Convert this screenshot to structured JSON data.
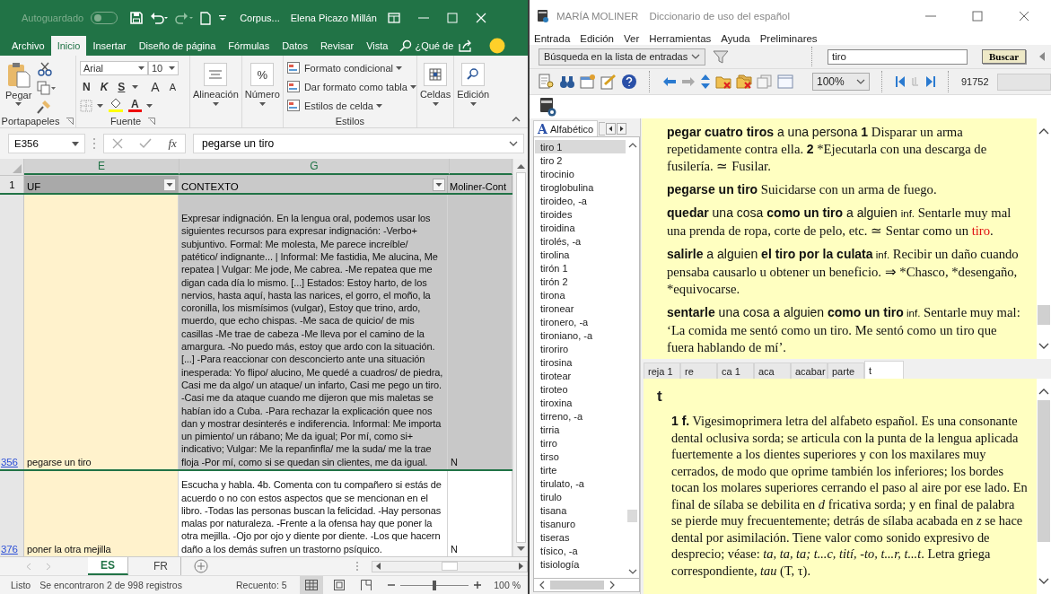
{
  "excel": {
    "titlebar": {
      "autosave_label": "Autoguardado",
      "autosave_on": false,
      "filename": "Corpus...",
      "user": "Elena Picazo Millán"
    },
    "ribbon_tabs": [
      {
        "label": "Archivo",
        "selected": false
      },
      {
        "label": "Inicio",
        "selected": true
      },
      {
        "label": "Insertar",
        "selected": false
      },
      {
        "label": "Diseño de página",
        "selected": false
      },
      {
        "label": "Fórmulas",
        "selected": false
      },
      {
        "label": "Datos",
        "selected": false
      },
      {
        "label": "Revisar",
        "selected": false
      },
      {
        "label": "Vista",
        "selected": false
      }
    ],
    "tell_me": "¿Qué de",
    "clipboard": {
      "paste": "Pegar",
      "group": "Portapapeles"
    },
    "font": {
      "name": "Arial",
      "size": "10",
      "bold": "N",
      "italic": "K",
      "underline": "S",
      "grow": "A",
      "shrink": "A",
      "font_color": "A",
      "group": "Fuente"
    },
    "alignment": "Alineación",
    "number": {
      "symbol": "%",
      "label": "Número"
    },
    "styles": {
      "items": [
        "Formato condicional",
        "Dar formato como tabla",
        "Estilos de celda"
      ],
      "group": "Estilos"
    },
    "cells": "Celdas",
    "editing": "Edición",
    "name_box": "E356",
    "function_label": "fx",
    "formula": "pegarse un tiro",
    "columns": [
      "E",
      "G"
    ],
    "header_row": {
      "number": "1",
      "cells": [
        "UF",
        "CONTEXTO",
        "Moliner-Cont"
      ]
    },
    "rows": [
      {
        "number": "356",
        "uf": "pegarse un tiro",
        "selected": true,
        "moliner": "N",
        "context": "Expresar indignación. En la lengua oral, podemos usar los siguientes recursos para expresar indignación: -Verbo+ subjuntivo. Formal: Me molesta, Me parece increíble/ patético/ indignante... | Informal: Me fastidia, Me alucina, Me repatea | Vulgar: Me jode, Me cabrea. -Me repatea que me digan cada día lo mismo. [...] Estados: Estoy harto, de los nervios, hasta aquí, hasta las narices, el gorro, el moño, la coronilla, los mismísimos (vulgar), Estoy que trino, ardo, muerdo, que echo chispas. -Me saca de quicio/ de mis casillas -Me trae de cabeza -Me lleva por el camino de la amargura. -No puedo más, estoy que ardo con la situación. [...] -Para reaccionar con desconcierto ante una situación inesperada: Yo flipo/ alucino, Me quedé a cuadros/ de piedra, Casi me da algo/ un ataque/ un infarto, Casi me pego un tiro. -Casi me da ataque cuando me dijeron que mis maletas se habían ido a Cuba. -Para rechazar la explicación quee nos dan y mostrar desinterés e indiferencia. Informal: Me importa un pimiento/ un rábano; Me da igual; Por mí, como si+ indicativo; Vulgar: Me la repanfinfla/ me la suda/ me la trae floja -Por mí, como si se quedan sin clientes, me da igual."
      },
      {
        "number": "376",
        "uf": "poner la otra mejilla",
        "selected": false,
        "moliner": "N",
        "context": "Escucha y habla. 4b. Comenta con tu compañero si estás de acuerdo o no con estos aspectos que se mencionan en el libro. -Todas las personas buscan la felicidad. -Hay personas malas por naturaleza. -Frente a la ofensa hay que poner la otra mejilla. -Ojo por ojo y diente por diente. -Los que hacern daño a los demás sufren un trastorno psíquico."
      }
    ],
    "sheets": [
      {
        "label": "ES",
        "selected": true
      },
      {
        "label": "FR",
        "selected": false
      }
    ],
    "status": {
      "ready": "Listo",
      "records": "Se encontraron 2 de 998 registros",
      "count": "Recuento: 5",
      "zoom": "100 %",
      "zoom_level": {
        "level": 0.5
      }
    }
  },
  "moliner": {
    "title": "MARÍA MOLINER",
    "subtitle": "Diccionario de uso del español",
    "menu": [
      "Entrada",
      "Edición",
      "Ver",
      "Herramientas",
      "Ayuda",
      "Preliminares"
    ],
    "search_mode": "Búsqueda en la lista de entradas",
    "search_value": "tiro",
    "search_button": "Buscar",
    "zoom": "100%",
    "entry_number": "91752",
    "index_tab": {
      "glyph": "A",
      "label": "Alfabético",
      "selected": true
    },
    "words": [
      {
        "label": "tiro 1",
        "selected": true
      },
      {
        "label": "tiro 2",
        "selected": false
      },
      {
        "label": "tirocinio",
        "selected": false
      },
      {
        "label": "tiroglobulina",
        "selected": false
      },
      {
        "label": "tiroideo, -a",
        "selected": false
      },
      {
        "label": "tiroides",
        "selected": false
      },
      {
        "label": "tiroidina",
        "selected": false
      },
      {
        "label": "tirolés, -a",
        "selected": false
      },
      {
        "label": "tirolina",
        "selected": false
      },
      {
        "label": "tirón 1",
        "selected": false
      },
      {
        "label": "tirón 2",
        "selected": false
      },
      {
        "label": "tirona",
        "selected": false
      },
      {
        "label": "tironear",
        "selected": false
      },
      {
        "label": "tironero, -a",
        "selected": false
      },
      {
        "label": "tironiano, -a",
        "selected": false
      },
      {
        "label": "tiroriro",
        "selected": false
      },
      {
        "label": "tirosina",
        "selected": false
      },
      {
        "label": "tirotear",
        "selected": false
      },
      {
        "label": "tiroteo",
        "selected": false
      },
      {
        "label": "tiroxina",
        "selected": false
      },
      {
        "label": "tirreno, -a",
        "selected": false
      },
      {
        "label": "tirria",
        "selected": false
      },
      {
        "label": "tirro",
        "selected": false
      },
      {
        "label": "tirso",
        "selected": false
      },
      {
        "label": "tirte",
        "selected": false
      },
      {
        "label": "tirulato, -a",
        "selected": false
      },
      {
        "label": "tirulo",
        "selected": false
      },
      {
        "label": "tisana",
        "selected": false
      },
      {
        "label": "tisanuro",
        "selected": false
      },
      {
        "label": "tiseras",
        "selected": false
      },
      {
        "label": "tísico, -a",
        "selected": false
      },
      {
        "label": "tisiología",
        "selected": false
      }
    ],
    "entries": [
      [
        {
          "kind": "phrase",
          "text": "pegar cuatro tiros"
        },
        {
          "kind": "sans",
          "text": " a una persona "
        },
        {
          "kind": "phrase",
          "text": "1"
        },
        {
          "kind": "def",
          "text": " Disparar un arma repetidamente contra ella. "
        },
        {
          "kind": "phrase",
          "text": "2"
        },
        {
          "kind": "def",
          "text": " *Ejecutarla con una descarga de fusilería. ≃ Fusilar."
        }
      ],
      [
        {
          "kind": "phrase",
          "text": "pegarse un tiro"
        },
        {
          "kind": "def",
          "text": " Suicidarse con un arma de fuego."
        }
      ],
      [
        {
          "kind": "phrase",
          "text": "quedar"
        },
        {
          "kind": "sans",
          "text": " una cosa "
        },
        {
          "kind": "phrase",
          "text": "como un tiro"
        },
        {
          "kind": "sans",
          "text": " a alguien "
        },
        {
          "kind": "label",
          "text": "inf."
        },
        {
          "kind": "def",
          "text": " Sentarle muy mal una prenda de ropa, corte de pelo, etc. ≃ Sentar como un "
        },
        {
          "kind": "link",
          "text": "tiro"
        },
        {
          "kind": "def",
          "text": "."
        }
      ],
      [
        {
          "kind": "phrase",
          "text": "salirle"
        },
        {
          "kind": "sans",
          "text": " a alguien "
        },
        {
          "kind": "phrase",
          "text": "el tiro por la culata"
        },
        {
          "kind": "label",
          "text": " inf."
        },
        {
          "kind": "def",
          "text": " Recibir un daño cuando pensaba causarlo u obtener un beneficio. ⇒ *Chasco, *desengaño, *equivocarse."
        }
      ],
      [
        {
          "kind": "phrase",
          "text": "sentarle"
        },
        {
          "kind": "sans",
          "text": " una cosa a alguien "
        },
        {
          "kind": "phrase",
          "text": "como un tiro"
        },
        {
          "kind": "label",
          "text": " inf."
        },
        {
          "kind": "def",
          "text": " Sentarle muy mal: ‘La comida me sentó como un tiro. Me sentó como un tiro que fuera hablando de mí’."
        }
      ]
    ],
    "history_tabs": [
      {
        "label": "reja 1",
        "selected": false
      },
      {
        "label": "re",
        "selected": false
      },
      {
        "label": "ca 1",
        "selected": false
      },
      {
        "label": "aca",
        "selected": false
      },
      {
        "label": "acabar",
        "selected": false
      },
      {
        "label": "parte",
        "selected": false
      },
      {
        "label": "t",
        "selected": true
      }
    ],
    "article": {
      "headword": "t",
      "body": [
        {
          "kind": "phrase",
          "text": "1"
        },
        {
          "kind": "phrase",
          "text": " f."
        },
        {
          "kind": "def",
          "text": " Vigesimoprimera letra del alfabeto español. Es una consonante dental oclusiva sorda; se articula con la punta de la lengua aplicada fuertemente a los dientes superiores y con los maxilares muy cerrados, de modo que oprime también los inferiores; los bordes tocan los molares superiores cerrando el paso al aire por ese lado. En final de sílaba se debilita en "
        },
        {
          "kind": "italic",
          "text": "d"
        },
        {
          "kind": "def",
          "text": " fricativa sorda; y en final de palabra se pierde muy frecuentemente; detrás de sílaba acabada en "
        },
        {
          "kind": "italic",
          "text": "z"
        },
        {
          "kind": "def",
          "text": " se hace dental por asimilación. Tiene valor como sonido expresivo de desprecio; véase: "
        },
        {
          "kind": "italic",
          "text": "ta, ta, ta; t...c, tití, -to, t...r, t...t"
        },
        {
          "kind": "def",
          "text": ". Letra griega correspondiente, "
        },
        {
          "kind": "italic",
          "text": "tau"
        },
        {
          "kind": "def",
          "text": " (Τ, τ)."
        }
      ]
    }
  }
}
